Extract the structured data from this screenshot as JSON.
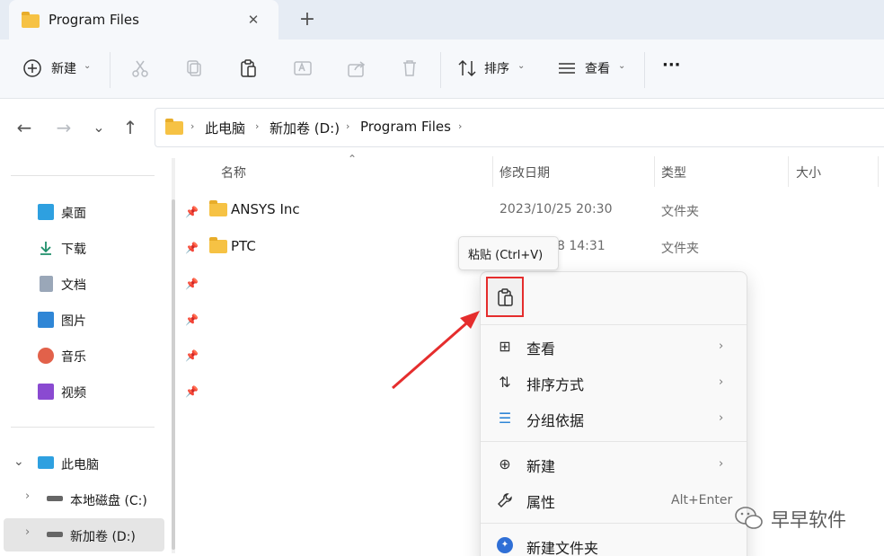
{
  "tab": {
    "title": "Program Files",
    "close_glyph": "✕",
    "new_tab_glyph": "+"
  },
  "toolbar": {
    "new_label": "新建",
    "sort_label": "排序",
    "view_label": "查看",
    "more_glyph": "···",
    "caret": "⌄"
  },
  "nav": {
    "back": "←",
    "forward": "→",
    "down": "⌄",
    "up": "↑"
  },
  "breadcrumb": [
    "此电脑",
    "新加卷 (D:)",
    "Program Files"
  ],
  "breadcrumb_sep": "›",
  "sidebar": {
    "quick": [
      {
        "label": "桌面",
        "icon": "desktop-icon",
        "color": "#2ea0e0"
      },
      {
        "label": "下载",
        "icon": "download-icon",
        "color": "#1e8f6a"
      },
      {
        "label": "文档",
        "icon": "document-icon",
        "color": "#7f8ea3"
      },
      {
        "label": "图片",
        "icon": "picture-icon",
        "color": "#2f86d6"
      },
      {
        "label": "音乐",
        "icon": "music-icon",
        "color": "#e2614a"
      },
      {
        "label": "视频",
        "icon": "video-icon",
        "color": "#8a4ad1"
      }
    ],
    "this_pc": "此电脑",
    "drives": [
      "本地磁盘 (C:)",
      "新加卷 (D:)"
    ],
    "pin_glyph": "📌",
    "expand_glyph": "›",
    "collapse_glyph": "⌄"
  },
  "columns": {
    "name": "名称",
    "modified": "修改日期",
    "type": "类型",
    "size": "大小",
    "sort_glyph": "⌃"
  },
  "files": [
    {
      "name": "ANSYS Inc",
      "modified": "2023/10/25 20:30",
      "type": "文件夹"
    },
    {
      "name": "PTC",
      "modified": "8 14:31",
      "type": "文件夹"
    }
  ],
  "tooltip": "粘贴 (Ctrl+V)",
  "menu": {
    "items": [
      {
        "label": "查看",
        "icon": "grid-icon",
        "glyph": "⊞",
        "chevron": "›"
      },
      {
        "label": "排序方式",
        "icon": "sort-icon",
        "glyph": "⇅",
        "chevron": "›"
      },
      {
        "label": "分组依据",
        "icon": "group-icon",
        "glyph": "☰",
        "chevron": "›"
      },
      {
        "label": "新建",
        "icon": "add-icon",
        "glyph": "⊕",
        "chevron": "›"
      },
      {
        "label": "属性",
        "icon": "wrench-icon",
        "glyph": "🔧",
        "shortcut": "Alt+Enter"
      },
      {
        "label": "新建文件夹",
        "icon": "new-folder-icon",
        "glyph": "✦"
      }
    ]
  },
  "watermark": "早早软件",
  "colors": {
    "highlight": "#e52d2d",
    "folder": "#f6c244",
    "accent": "#2f86d6"
  }
}
